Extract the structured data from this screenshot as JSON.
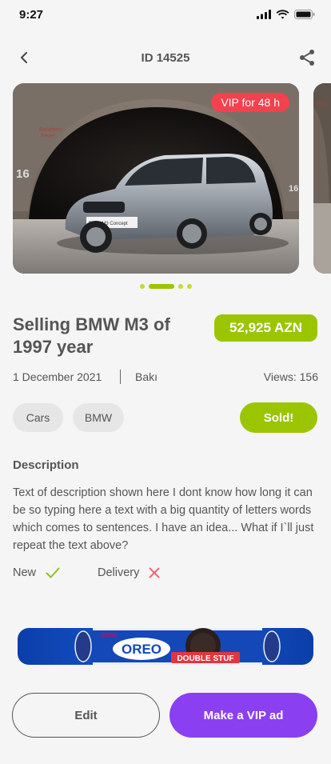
{
  "status_bar": {
    "time": "9:27"
  },
  "header": {
    "id_label": "ID 14525"
  },
  "gallery": {
    "vip_badge": "VIP for 48 h",
    "slide_count": 4,
    "active_index": 1
  },
  "listing": {
    "title": "Selling BMW M3 of 1997 year",
    "price": "52,925 AZN",
    "date": "1 December 2021",
    "city": "Bakı",
    "views": "Views: 156",
    "tags": [
      "Cars",
      "BMW"
    ],
    "status_label": "Sold!"
  },
  "description": {
    "heading": "Description",
    "text": "Text of description shown here I dont know how long it can be so typing here a text with a big quantity of letters words which comes to sentences. I have an idea... What if I`ll just repeat the text above?"
  },
  "features": [
    {
      "label": "New",
      "value": true
    },
    {
      "label": "Delivery",
      "value": false
    }
  ],
  "banner": {
    "brand": "OREO",
    "subtext": "DOUBLE STUF"
  },
  "actions": {
    "edit_label": "Edit",
    "vip_label": "Make a VIP ad"
  },
  "colors": {
    "accent_green": "#9BC500",
    "vip_red": "#F3414E",
    "primary_purple": "#8A3FF0",
    "check_green": "#8CC21A",
    "cross_red": "#F06A73"
  }
}
